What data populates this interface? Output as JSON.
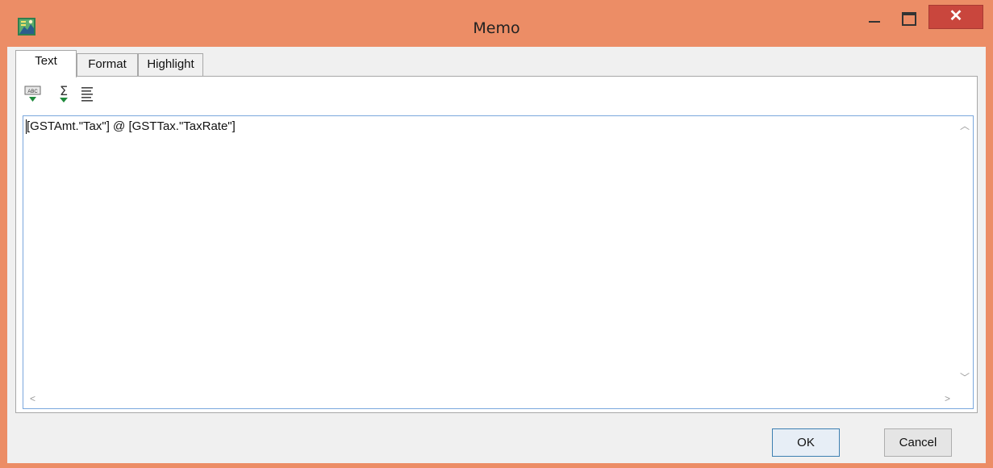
{
  "window": {
    "title": "Memo",
    "close_label": "✕",
    "accent_color": "#ec8d66"
  },
  "tabs": [
    {
      "label": "Text",
      "active": true
    },
    {
      "label": "Format",
      "active": false
    },
    {
      "label": "Highlight",
      "active": false
    }
  ],
  "toolbar": {
    "icons": [
      "insert-field-icon",
      "insert-aggregate-icon",
      "word-wrap-icon"
    ]
  },
  "editor": {
    "content": "[GSTAmt.\"Tax\"] @ [GSTTax.\"TaxRate\"]"
  },
  "buttons": {
    "ok_label": "OK",
    "cancel_label": "Cancel"
  }
}
